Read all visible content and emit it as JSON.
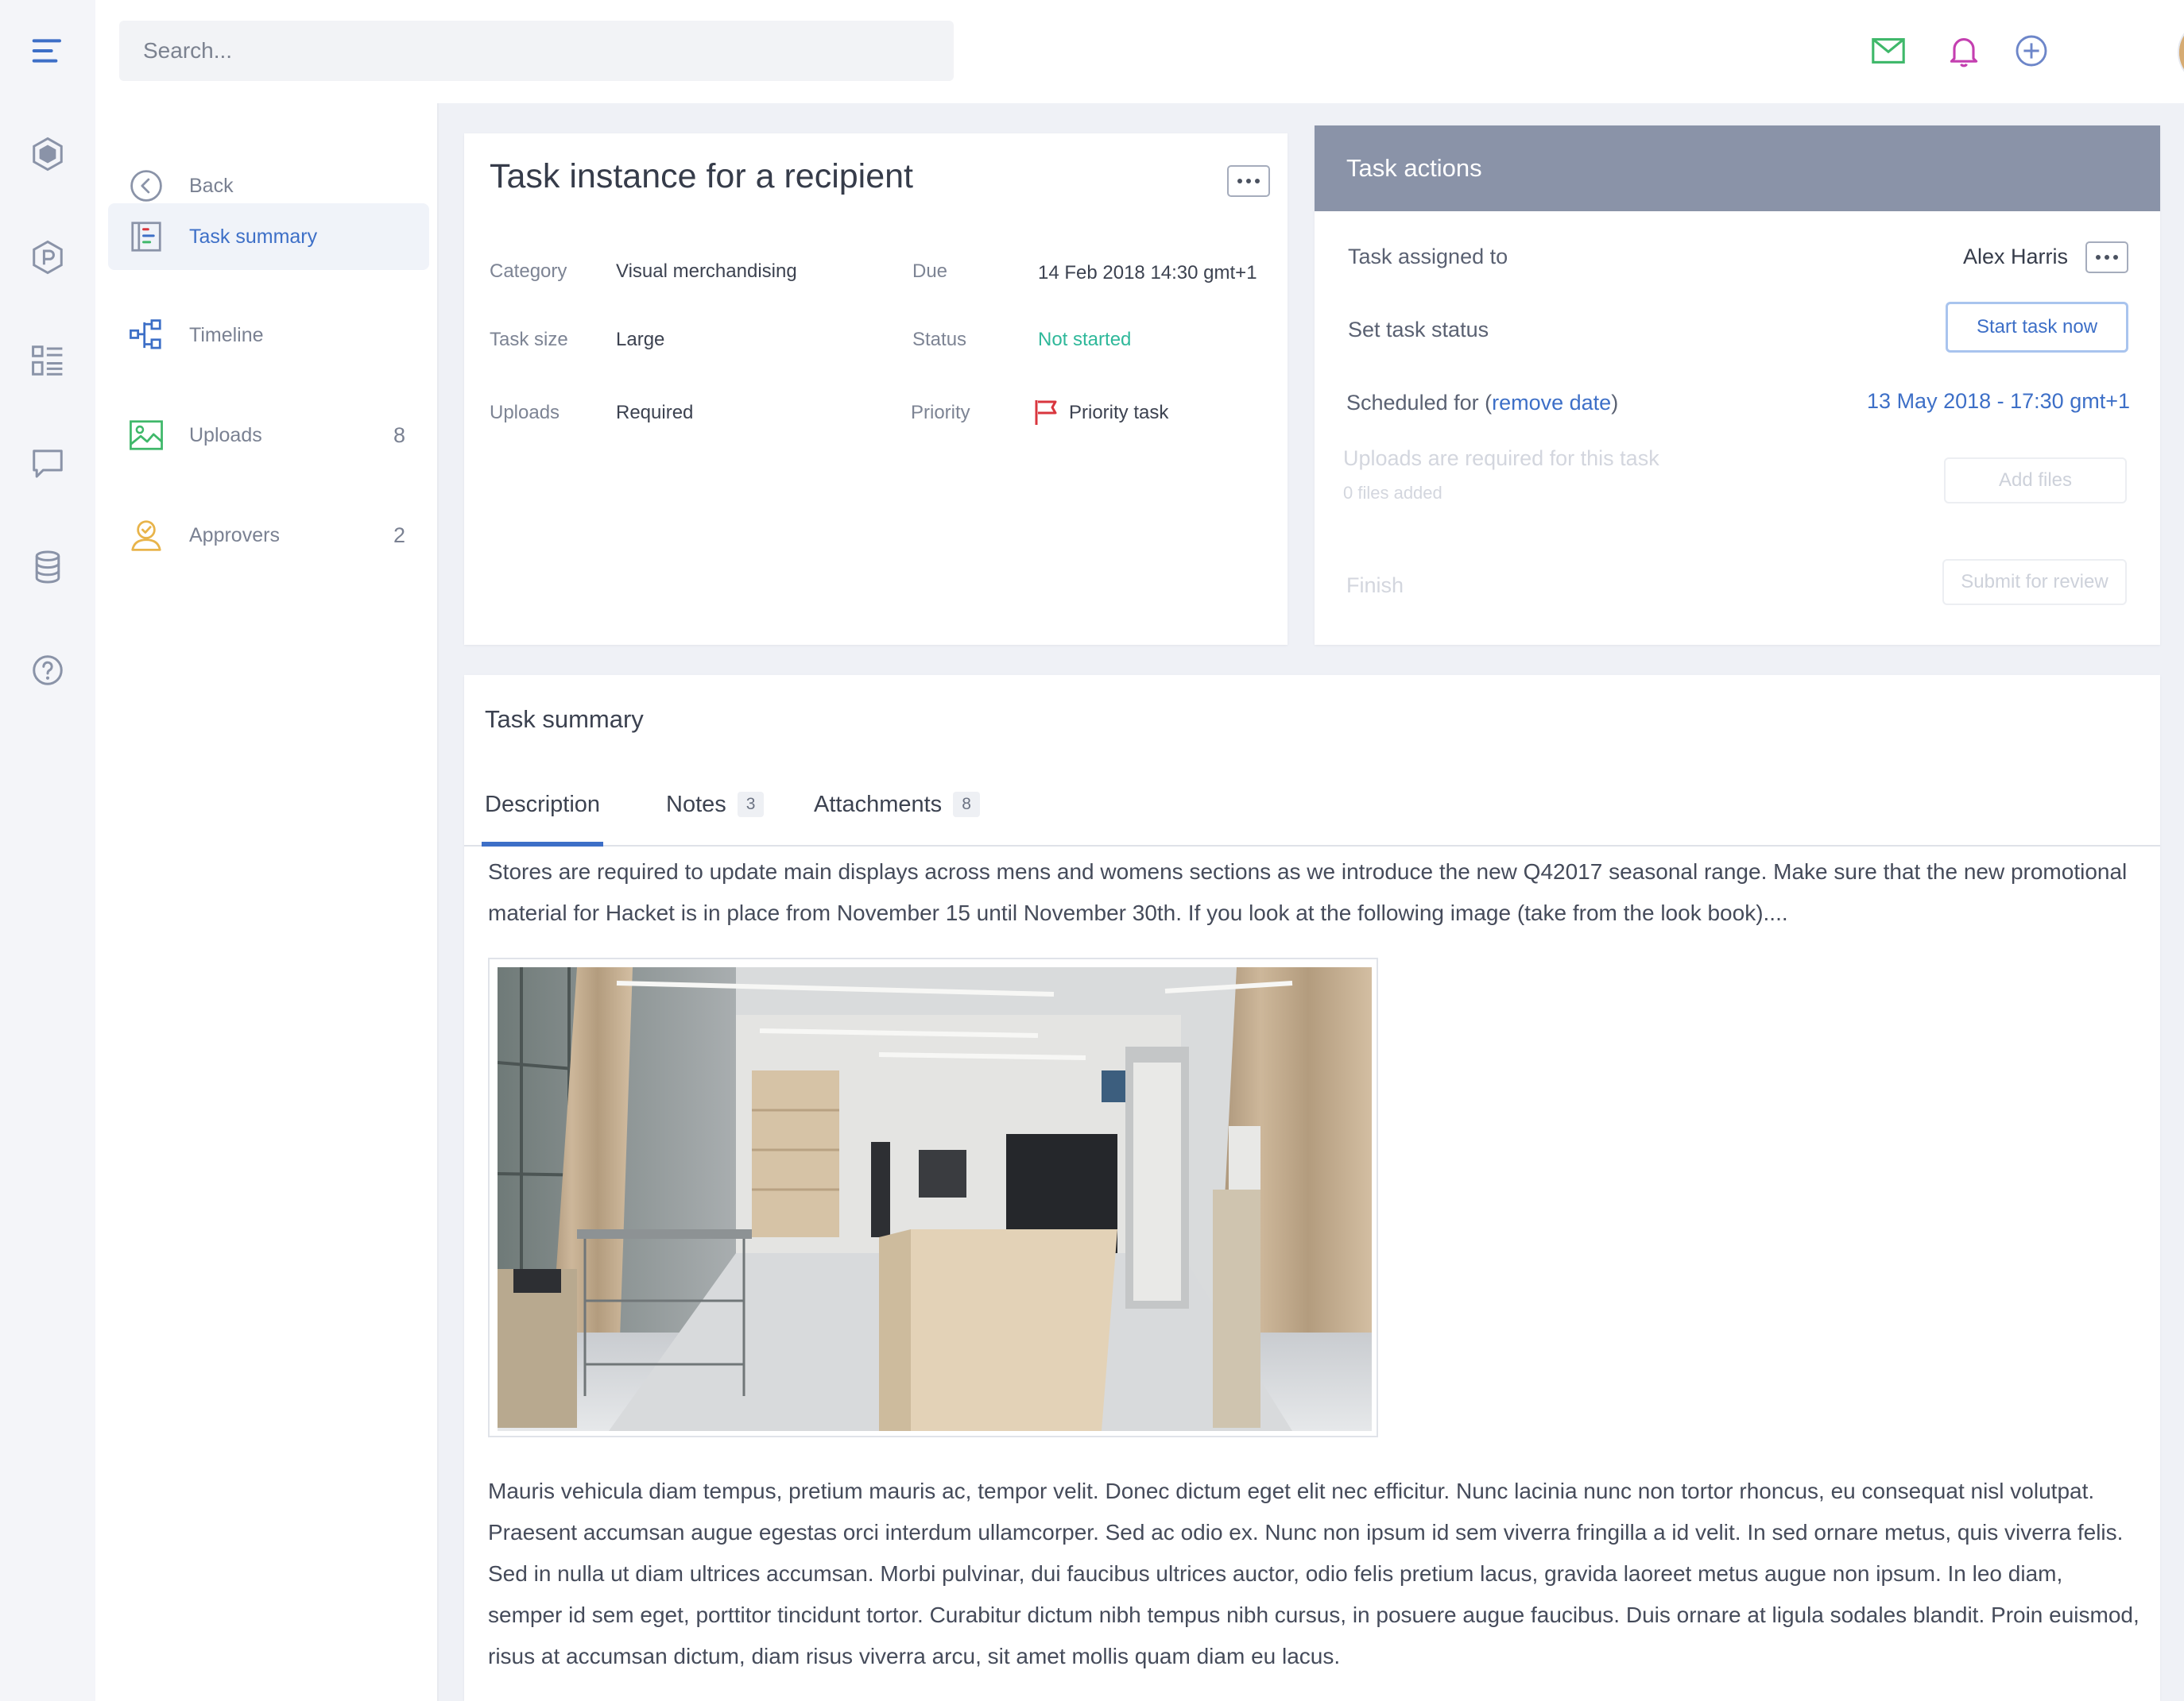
{
  "search": {
    "placeholder": "Search..."
  },
  "sidebar": {
    "items": [
      {
        "label": "Back",
        "count": ""
      },
      {
        "label": "Task summary",
        "count": ""
      },
      {
        "label": "Timeline",
        "count": ""
      },
      {
        "label": "Uploads",
        "count": "8"
      },
      {
        "label": "Approvers",
        "count": "2"
      }
    ]
  },
  "task": {
    "title": "Task instance for a recipient",
    "fields": [
      {
        "label": "Category",
        "value": "Visual merchandising"
      },
      {
        "label": "Due",
        "value": "14 Feb 2018 14:30 gmt+1"
      },
      {
        "label": "Task size",
        "value": "Large"
      },
      {
        "label": "Status",
        "value": "Not started"
      },
      {
        "label": "Uploads",
        "value": "Required"
      },
      {
        "label": "Priority",
        "value": "Priority task"
      }
    ]
  },
  "actions": {
    "title": "Task actions",
    "assigned_label": "Task assigned to",
    "assigned_value": "Alex Harris",
    "status_label": "Set task status",
    "start_button": "Start task now",
    "scheduled_label_pre": "Scheduled for (",
    "scheduled_link": "remove date",
    "scheduled_label_post": ")",
    "scheduled_value": "13 May 2018 - 17:30 gmt+1",
    "uploads_label": "Uploads are required for this task",
    "uploads_sub": "0 files added",
    "add_files_button": "Add files",
    "finish_label": "Finish",
    "submit_button": "Submit for review"
  },
  "summary": {
    "title": "Task summary",
    "tabs": [
      {
        "label": "Description",
        "badge": ""
      },
      {
        "label": "Notes",
        "badge": "3"
      },
      {
        "label": "Attachments",
        "badge": "8"
      }
    ],
    "paragraph1": "Stores are required to update main displays across mens and womens sections as we introduce the new Q42017 seasonal range. Make sure that the new promotional material for Hacket is in place from November 15 until November 30th. If you look at the following image (take from the look book)....",
    "paragraph2": "Mauris vehicula diam tempus, pretium mauris ac, tempor velit. Donec dictum eget elit nec efficitur. Nunc lacinia nunc non tortor rhoncus, eu consequat nisl volutpat. Praesent accumsan augue egestas orci interdum ullamcorper. Sed ac odio ex. Nunc non ipsum id sem viverra fringilla a id velit. In sed ornare metus, quis viverra felis. Sed in nulla ut diam ultrices accumsan. Morbi pulvinar, dui faucibus ultrices auctor, odio felis pretium lacus, gravida laoreet metus augue non ipsum. In leo diam, semper id sem eget, porttitor tincidunt tortor. Curabitur dictum nibh tempus nibh cursus, in posuere augue faucibus. Duis ornare at ligula sodales blandit. Proin euismod, risus at accumsan dictum, diam risus viverra arcu, sit amet mollis quam diam eu lacus."
  },
  "colors": {
    "accent": "#3d6fc7",
    "status_green": "#2fb89a",
    "priority_red": "#d9363e",
    "header_gray": "#8a93a8"
  }
}
